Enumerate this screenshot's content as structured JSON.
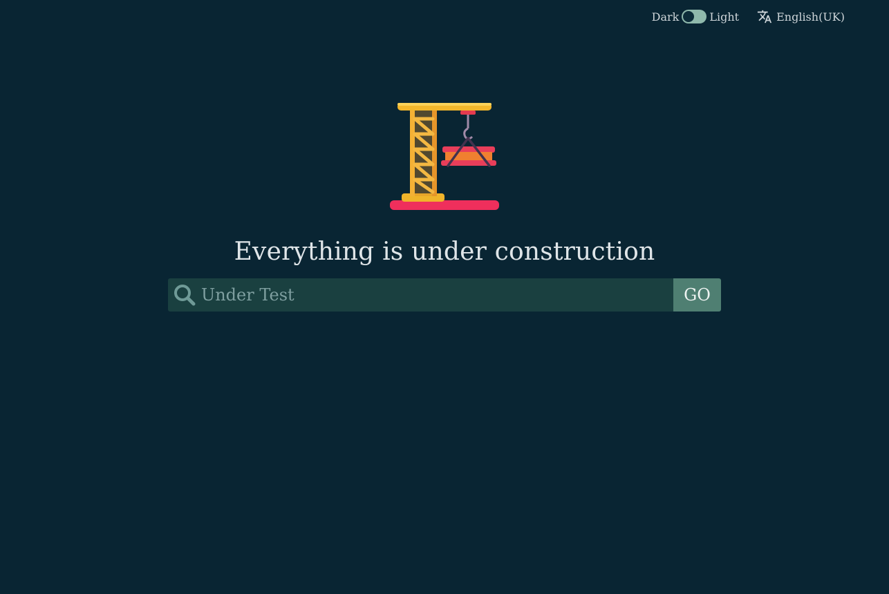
{
  "theme_toggle": {
    "dark_label": "Dark",
    "light_label": "Light"
  },
  "language": {
    "icon": "translate-icon",
    "current": "English(UK)"
  },
  "illustration": {
    "icon": "construction-crane-icon"
  },
  "headline": "Everything is under construction",
  "search": {
    "icon": "search-icon",
    "placeholder": "Under Test",
    "value": "",
    "button_label": "GO"
  },
  "colors": {
    "background": "#092533",
    "search_field": "#1a4040",
    "button": "#4f7f72",
    "toggle": "#8fb9ac"
  }
}
